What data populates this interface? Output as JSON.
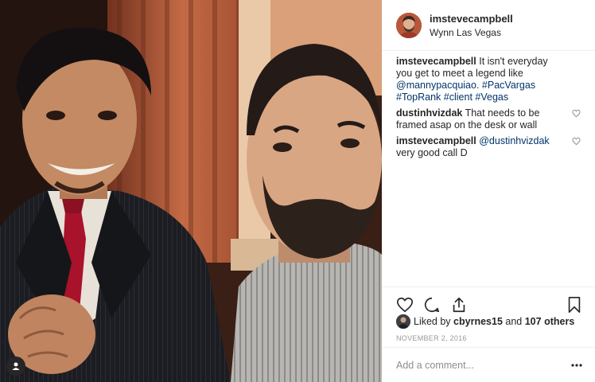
{
  "post": {
    "username": "imsteve​campbell",
    "location": "Wynn Las Vegas"
  },
  "caption": {
    "user": "imsteve​campbell",
    "text_1": "It isn't everyday you get to meet a legend like",
    "mention": "@mannypacquiao",
    "text_2": ".",
    "tag_1": "#PacVargas",
    "tag_2": "#TopRank",
    "tag_3": "#client",
    "tag_4": "#Vegas"
  },
  "comments": [
    {
      "user": "dustinhvizdak",
      "text": "That needs to be framed asap on the desk or wall"
    },
    {
      "user": "imsteve​campbell",
      "mention": "@dustinhvizdak",
      "text": "very good call D"
    }
  ],
  "likes": {
    "prefix": "Liked by",
    "user": "cbyrnes15",
    "middle": "and",
    "others": "107 others"
  },
  "date": "November 2, 2016",
  "comment_input": {
    "placeholder": "Add a comment..."
  },
  "icons": {
    "like": "heart-icon",
    "comment": "comment-bubble-icon",
    "share": "share-icon",
    "save": "bookmark-icon",
    "more": "more-dots-icon",
    "tag": "user-tag-icon"
  },
  "colors": {
    "text": "#262626",
    "link": "#003569",
    "muted": "#8e8e8e",
    "divider": "#efefef"
  }
}
